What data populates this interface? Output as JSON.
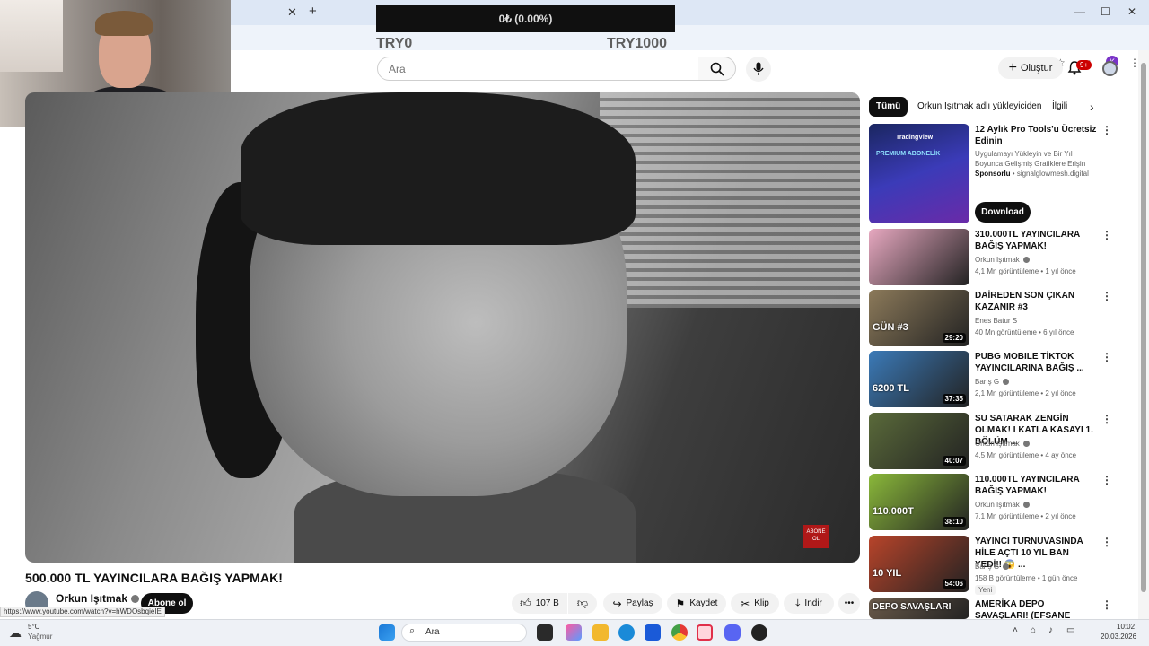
{
  "browser": {
    "tab_close": "✕",
    "tab_new": "+",
    "win_min": "—",
    "win_max": "☐",
    "win_close": "✕",
    "profile_letter": "K"
  },
  "donation": {
    "amount": "0₺ (0.00%)",
    "min": "TRY0",
    "max": "TRY1000"
  },
  "header": {
    "search_placeholder": "Ara",
    "create_label": "Oluştur",
    "notifications_badge": "9+"
  },
  "video": {
    "title": "500.000 TL YAYINCILARA BAĞIŞ YAPMAK!",
    "channel": "Orkun Işıtmak",
    "subscribe_label": "Abone ol",
    "likes": "107 B",
    "share_label": "Paylaş",
    "save_label": "Kaydet",
    "clip_label": "Klip",
    "download_label": "İndir",
    "more_label": "•••",
    "logo_text": "ABONE OL"
  },
  "status_url": "https://www.youtube.com/watch?v=hWDOsbqieIE",
  "chips": [
    "Tümü",
    "Orkun Işıtmak adlı yükleyiciden",
    "İlgili"
  ],
  "sponsored": {
    "title": "12 Aylık Pro Tools'u Ücretsiz Edinin",
    "description": "Uygulamayı Yükleyin ve Bir Yıl Boyunca Gelişmiş Grafiklere Erişin",
    "sponsor_label": "Sponsorlu",
    "domain": "signalglowmesh.digital",
    "download_label": "Download",
    "thumb_brand": "TradingView",
    "thumb_caption": "PREMIUM ABONELİK"
  },
  "recommendations": [
    {
      "title": "310.000TL YAYINCILARA BAĞIŞ YAPMAK!",
      "channel": "Orkun Işıtmak",
      "verified": true,
      "meta": "4,1 Mn görüntüleme • 1 yıl önce",
      "duration": "",
      "color": "#e7a8c0"
    },
    {
      "title": "DAİREDEN SON ÇIKAN KAZANIR #3",
      "channel": "Enes Batur S",
      "verified": false,
      "meta": "40 Mn görüntüleme • 6 yıl önce",
      "duration": "29:20",
      "color": "#8c7a5a",
      "thumb_text": "GÜN #3"
    },
    {
      "title": "PUBG MOBILE TİKTOK YAYINCILARINA BAĞIŞ ...",
      "channel": "Barış G",
      "verified": true,
      "meta": "2,1 Mn görüntüleme • 2 yıl önce",
      "duration": "37:35",
      "color": "#3b7ab8",
      "thumb_text": "6200 TL"
    },
    {
      "title": "SU SATARAK ZENGİN OLMAK! I KATLA KASAYI 1. BÖLÜM ...",
      "channel": "Orkun Işıtmak",
      "verified": true,
      "meta": "4,5 Mn görüntüleme • 4 ay önce",
      "duration": "40:07",
      "color": "#5a6a3a"
    },
    {
      "title": "110.000TL YAYINCILARA BAĞIŞ YAPMAK!",
      "channel": "Orkun Işıtmak",
      "verified": true,
      "meta": "7,1 Mn görüntüleme • 2 yıl önce",
      "duration": "38:10",
      "color": "#8ab83a",
      "thumb_text": "110.000T"
    },
    {
      "title": "YAYINCI TURNUVASINDA HİLE AÇTI 10 YIL BAN YEDİ!! 😱 ...",
      "channel": "Barış G",
      "verified": true,
      "meta": "158 B görüntüleme • 1 gün önce",
      "duration": "54:06",
      "color": "#b8442a",
      "thumb_text": "10 YIL"
    },
    {
      "title": "AMERİKA DEPO SAVAŞLARI! (EFSANE VİDEO)",
      "channel": "",
      "verified": false,
      "meta": "",
      "duration": "",
      "color": "#6a5a4a",
      "thumb_text": "DEPO SAVAŞLARI"
    }
  ],
  "new_badge": "Yeni",
  "taskbar": {
    "weather_temp": "5°C",
    "weather_desc": "Yağmur",
    "search_label": "Ara",
    "time": "10:02",
    "date": "20.03.2026"
  }
}
